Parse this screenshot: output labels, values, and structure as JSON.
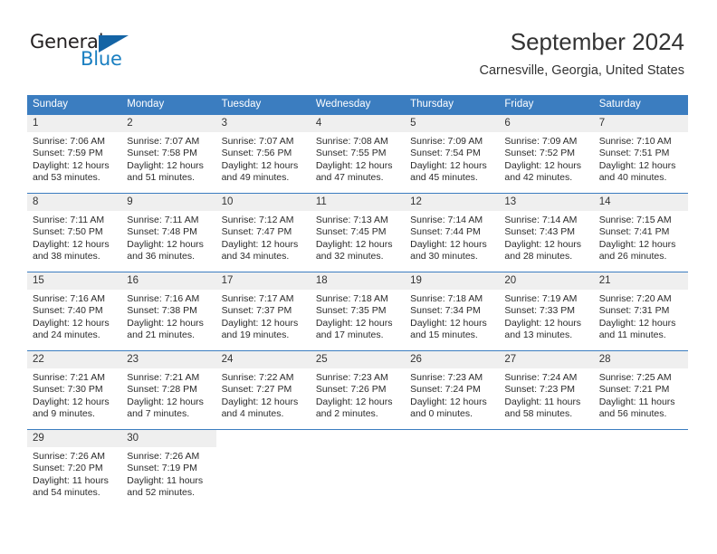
{
  "brand": {
    "name_part1": "General",
    "name_part2": "Blue",
    "logo_icon": "triangle-logo-icon"
  },
  "header": {
    "title": "September 2024",
    "location": "Carnesville, Georgia, United States"
  },
  "colors": {
    "header_row_bg": "#3b7dc0",
    "header_row_text": "#ffffff",
    "daynum_bg": "#efefef",
    "brand_blue": "#1a7fc1",
    "cell_border": "#3b7dc0",
    "body_text": "#2b2b2b"
  },
  "calendar": {
    "weekday_headers": [
      "Sunday",
      "Monday",
      "Tuesday",
      "Wednesday",
      "Thursday",
      "Friday",
      "Saturday"
    ],
    "weeks": [
      [
        {
          "day": "1",
          "sunrise": "Sunrise: 7:06 AM",
          "sunset": "Sunset: 7:59 PM",
          "daylight": "Daylight: 12 hours and 53 minutes."
        },
        {
          "day": "2",
          "sunrise": "Sunrise: 7:07 AM",
          "sunset": "Sunset: 7:58 PM",
          "daylight": "Daylight: 12 hours and 51 minutes."
        },
        {
          "day": "3",
          "sunrise": "Sunrise: 7:07 AM",
          "sunset": "Sunset: 7:56 PM",
          "daylight": "Daylight: 12 hours and 49 minutes."
        },
        {
          "day": "4",
          "sunrise": "Sunrise: 7:08 AM",
          "sunset": "Sunset: 7:55 PM",
          "daylight": "Daylight: 12 hours and 47 minutes."
        },
        {
          "day": "5",
          "sunrise": "Sunrise: 7:09 AM",
          "sunset": "Sunset: 7:54 PM",
          "daylight": "Daylight: 12 hours and 45 minutes."
        },
        {
          "day": "6",
          "sunrise": "Sunrise: 7:09 AM",
          "sunset": "Sunset: 7:52 PM",
          "daylight": "Daylight: 12 hours and 42 minutes."
        },
        {
          "day": "7",
          "sunrise": "Sunrise: 7:10 AM",
          "sunset": "Sunset: 7:51 PM",
          "daylight": "Daylight: 12 hours and 40 minutes."
        }
      ],
      [
        {
          "day": "8",
          "sunrise": "Sunrise: 7:11 AM",
          "sunset": "Sunset: 7:50 PM",
          "daylight": "Daylight: 12 hours and 38 minutes."
        },
        {
          "day": "9",
          "sunrise": "Sunrise: 7:11 AM",
          "sunset": "Sunset: 7:48 PM",
          "daylight": "Daylight: 12 hours and 36 minutes."
        },
        {
          "day": "10",
          "sunrise": "Sunrise: 7:12 AM",
          "sunset": "Sunset: 7:47 PM",
          "daylight": "Daylight: 12 hours and 34 minutes."
        },
        {
          "day": "11",
          "sunrise": "Sunrise: 7:13 AM",
          "sunset": "Sunset: 7:45 PM",
          "daylight": "Daylight: 12 hours and 32 minutes."
        },
        {
          "day": "12",
          "sunrise": "Sunrise: 7:14 AM",
          "sunset": "Sunset: 7:44 PM",
          "daylight": "Daylight: 12 hours and 30 minutes."
        },
        {
          "day": "13",
          "sunrise": "Sunrise: 7:14 AM",
          "sunset": "Sunset: 7:43 PM",
          "daylight": "Daylight: 12 hours and 28 minutes."
        },
        {
          "day": "14",
          "sunrise": "Sunrise: 7:15 AM",
          "sunset": "Sunset: 7:41 PM",
          "daylight": "Daylight: 12 hours and 26 minutes."
        }
      ],
      [
        {
          "day": "15",
          "sunrise": "Sunrise: 7:16 AM",
          "sunset": "Sunset: 7:40 PM",
          "daylight": "Daylight: 12 hours and 24 minutes."
        },
        {
          "day": "16",
          "sunrise": "Sunrise: 7:16 AM",
          "sunset": "Sunset: 7:38 PM",
          "daylight": "Daylight: 12 hours and 21 minutes."
        },
        {
          "day": "17",
          "sunrise": "Sunrise: 7:17 AM",
          "sunset": "Sunset: 7:37 PM",
          "daylight": "Daylight: 12 hours and 19 minutes."
        },
        {
          "day": "18",
          "sunrise": "Sunrise: 7:18 AM",
          "sunset": "Sunset: 7:35 PM",
          "daylight": "Daylight: 12 hours and 17 minutes."
        },
        {
          "day": "19",
          "sunrise": "Sunrise: 7:18 AM",
          "sunset": "Sunset: 7:34 PM",
          "daylight": "Daylight: 12 hours and 15 minutes."
        },
        {
          "day": "20",
          "sunrise": "Sunrise: 7:19 AM",
          "sunset": "Sunset: 7:33 PM",
          "daylight": "Daylight: 12 hours and 13 minutes."
        },
        {
          "day": "21",
          "sunrise": "Sunrise: 7:20 AM",
          "sunset": "Sunset: 7:31 PM",
          "daylight": "Daylight: 12 hours and 11 minutes."
        }
      ],
      [
        {
          "day": "22",
          "sunrise": "Sunrise: 7:21 AM",
          "sunset": "Sunset: 7:30 PM",
          "daylight": "Daylight: 12 hours and 9 minutes."
        },
        {
          "day": "23",
          "sunrise": "Sunrise: 7:21 AM",
          "sunset": "Sunset: 7:28 PM",
          "daylight": "Daylight: 12 hours and 7 minutes."
        },
        {
          "day": "24",
          "sunrise": "Sunrise: 7:22 AM",
          "sunset": "Sunset: 7:27 PM",
          "daylight": "Daylight: 12 hours and 4 minutes."
        },
        {
          "day": "25",
          "sunrise": "Sunrise: 7:23 AM",
          "sunset": "Sunset: 7:26 PM",
          "daylight": "Daylight: 12 hours and 2 minutes."
        },
        {
          "day": "26",
          "sunrise": "Sunrise: 7:23 AM",
          "sunset": "Sunset: 7:24 PM",
          "daylight": "Daylight: 12 hours and 0 minutes."
        },
        {
          "day": "27",
          "sunrise": "Sunrise: 7:24 AM",
          "sunset": "Sunset: 7:23 PM",
          "daylight": "Daylight: 11 hours and 58 minutes."
        },
        {
          "day": "28",
          "sunrise": "Sunrise: 7:25 AM",
          "sunset": "Sunset: 7:21 PM",
          "daylight": "Daylight: 11 hours and 56 minutes."
        }
      ],
      [
        {
          "day": "29",
          "sunrise": "Sunrise: 7:26 AM",
          "sunset": "Sunset: 7:20 PM",
          "daylight": "Daylight: 11 hours and 54 minutes."
        },
        {
          "day": "30",
          "sunrise": "Sunrise: 7:26 AM",
          "sunset": "Sunset: 7:19 PM",
          "daylight": "Daylight: 11 hours and 52 minutes."
        },
        {
          "day": "",
          "sunrise": "",
          "sunset": "",
          "daylight": ""
        },
        {
          "day": "",
          "sunrise": "",
          "sunset": "",
          "daylight": ""
        },
        {
          "day": "",
          "sunrise": "",
          "sunset": "",
          "daylight": ""
        },
        {
          "day": "",
          "sunrise": "",
          "sunset": "",
          "daylight": ""
        },
        {
          "day": "",
          "sunrise": "",
          "sunset": "",
          "daylight": ""
        }
      ]
    ]
  }
}
